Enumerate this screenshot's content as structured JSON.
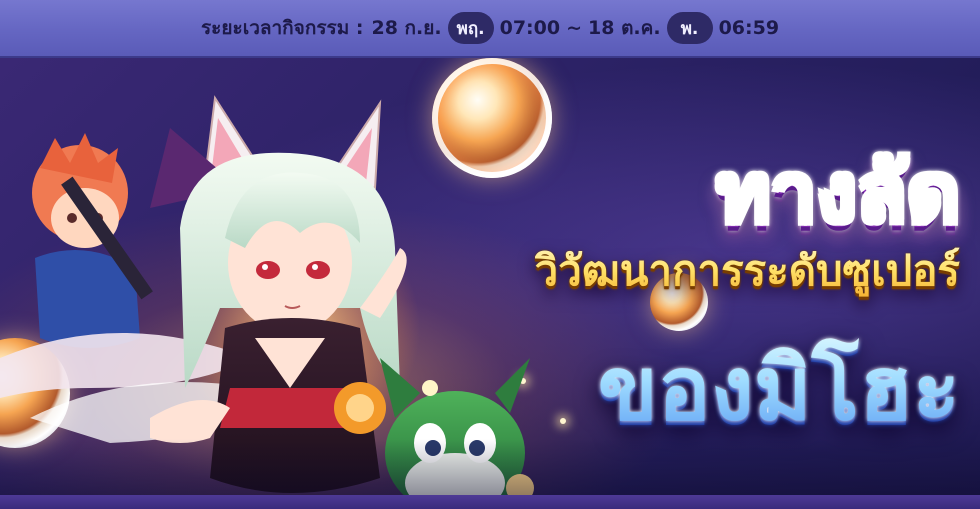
{
  "event_period": {
    "label": "ระยะเวลากิจกรรม :",
    "start_date": "28 ก.ย.",
    "start_day": "พฤ.",
    "start_time": "07:00",
    "separator": "~",
    "end_date": "18 ต.ค.",
    "end_day": "พ.",
    "end_time": "06:59"
  },
  "banner": {
    "title_line1": "ทางลัด",
    "title_line2": "วิวัฒนาการระดับซูเปอร์",
    "title_line3": "ของมิโฮะ"
  },
  "colors": {
    "period_bar": "#6566c2",
    "day_pill": "#2e2a66",
    "banner_bg": "#2c2266",
    "title1": "#ec7cf6",
    "title2": "#ffe066",
    "title3": "#9fdcff"
  }
}
